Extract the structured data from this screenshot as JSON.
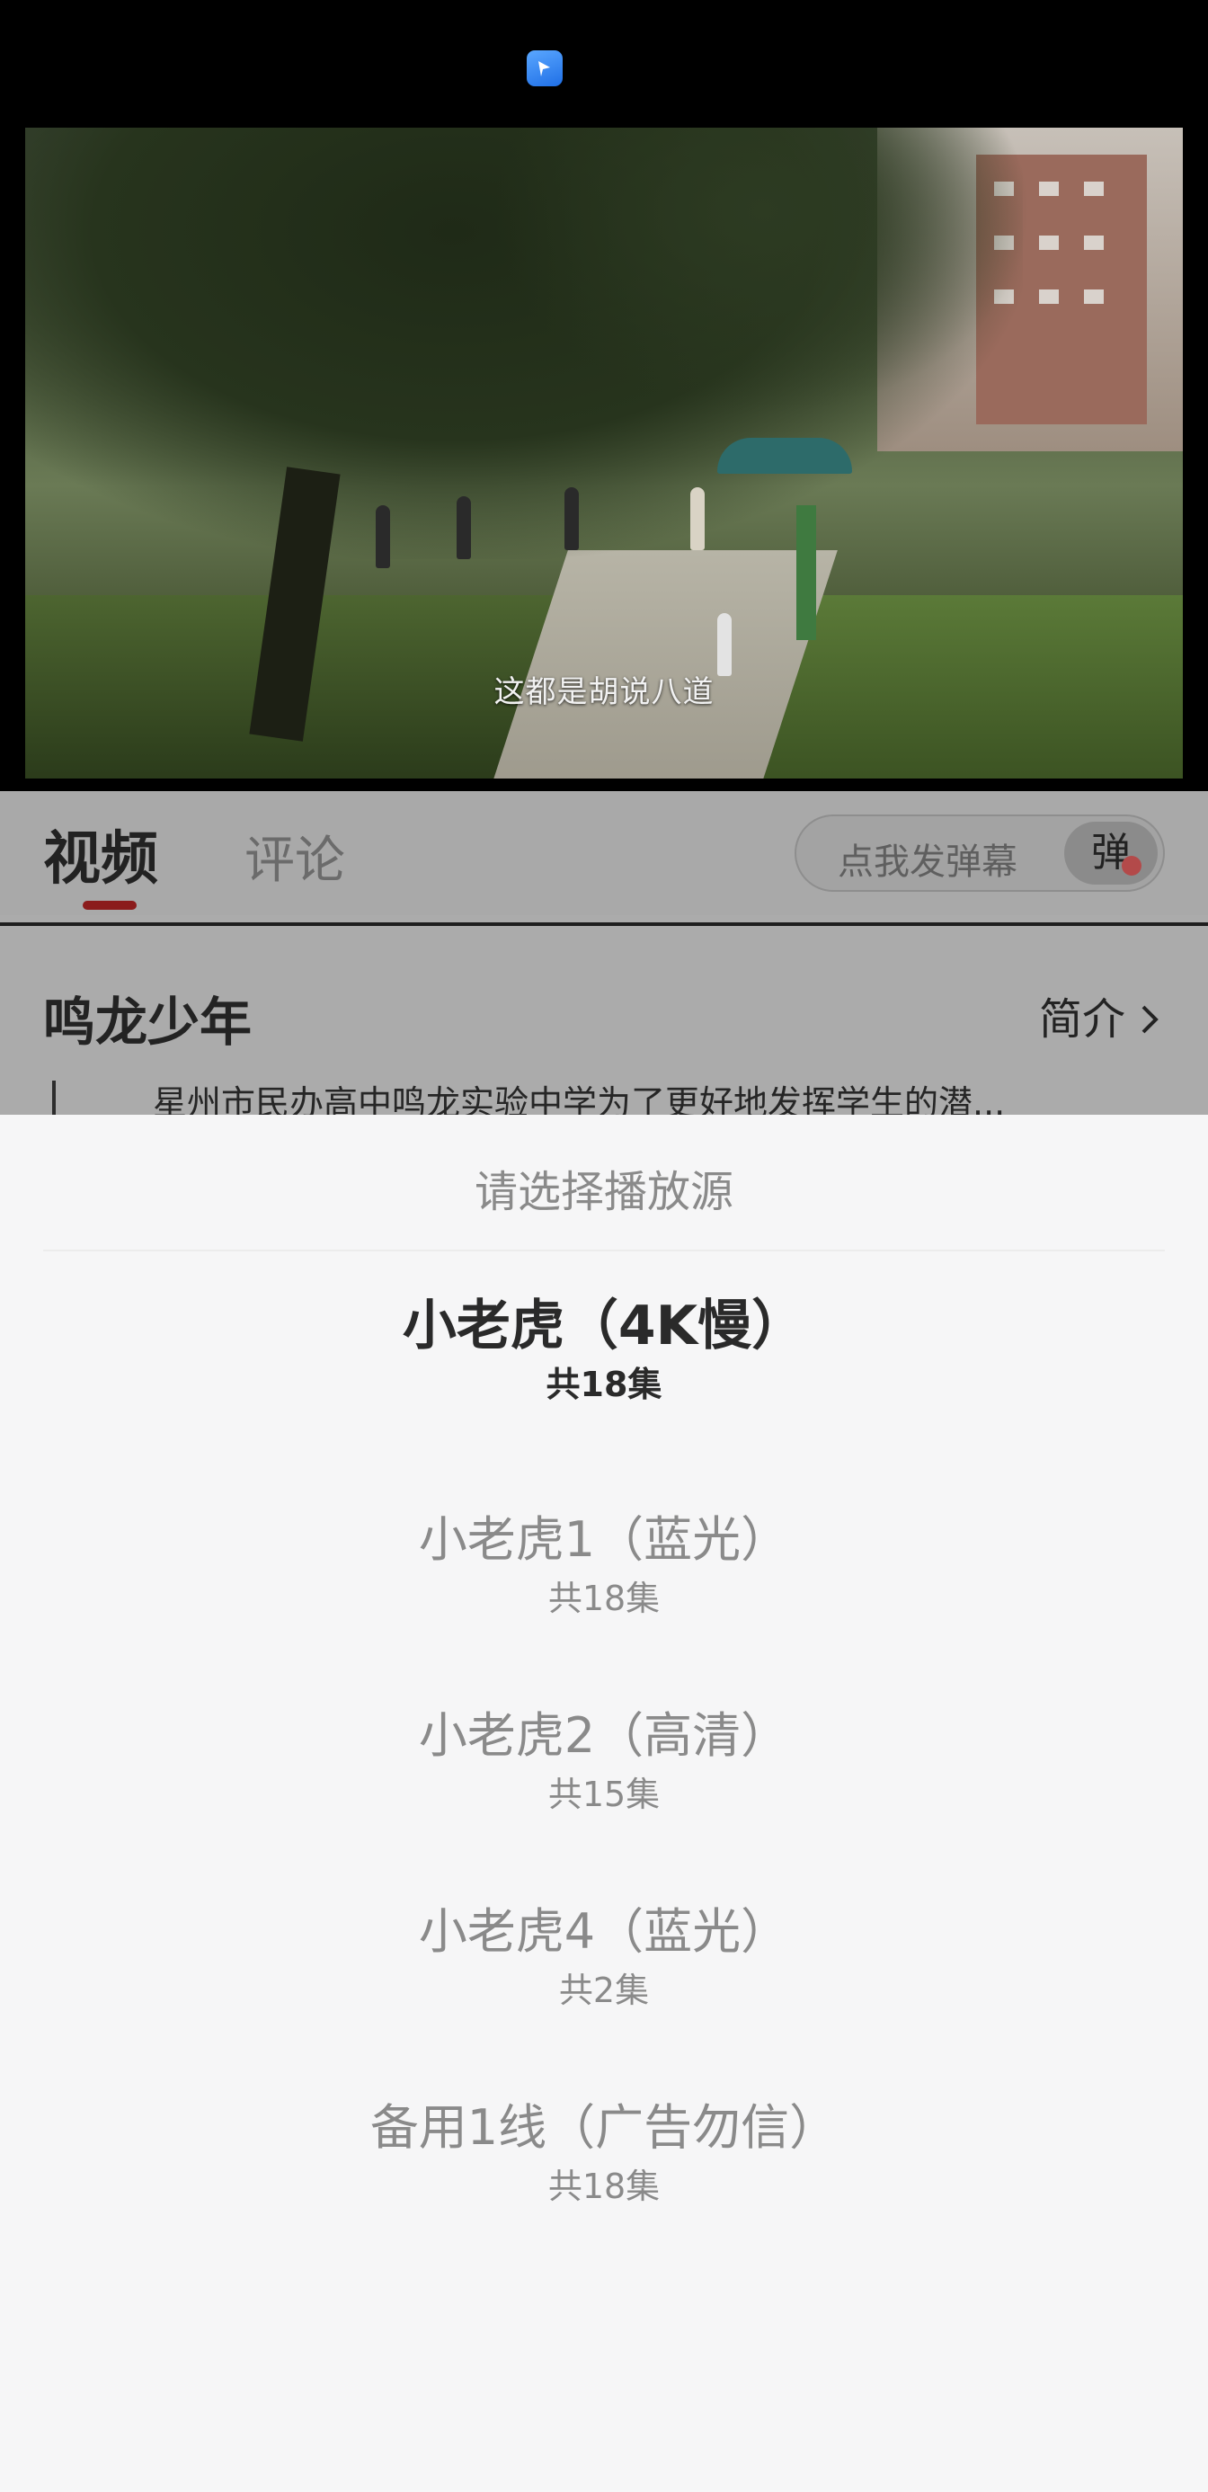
{
  "icons": {
    "app_badge": "app-notification-icon",
    "intro_chevron": "chevron-right-icon"
  },
  "video": {
    "subtitle": "这都是胡说八道"
  },
  "tabs": [
    {
      "label": "视频",
      "active": true
    },
    {
      "label": "评论",
      "active": false
    }
  ],
  "danmu": {
    "placeholder": "点我发弹幕",
    "button_label": "弹"
  },
  "show": {
    "title": "鸣龙少年",
    "intro_label": "简介",
    "description": "星州市民办高中鸣龙实验中学为了更好地发挥学生的潜..."
  },
  "sheet": {
    "title": "请选择播放源",
    "sources": [
      {
        "name": "小老虎（4K慢）",
        "count": "共18集",
        "active": true
      },
      {
        "name": "小老虎1（蓝光）",
        "count": "共18集",
        "active": false
      },
      {
        "name": "小老虎2（高清）",
        "count": "共15集",
        "active": false
      },
      {
        "name": "小老虎4（蓝光）",
        "count": "共2集",
        "active": false
      },
      {
        "name": "备用1线（广告勿信）",
        "count": "共18集",
        "active": false
      }
    ]
  },
  "colors": {
    "tab_indicator": "#8b1b1b",
    "sheet_background": "#f6f6f7",
    "active_text": "#2a2a2a",
    "inactive_text": "#8a8a8a"
  }
}
